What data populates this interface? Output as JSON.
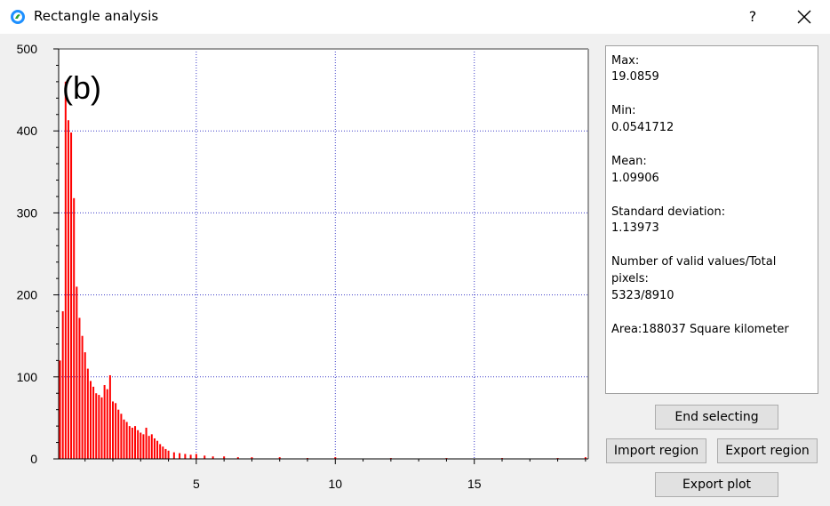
{
  "window": {
    "title": "Rectangle analysis",
    "help_label": "?",
    "accent_color": "#1e90ff"
  },
  "chart_data": {
    "type": "bar",
    "annotation": "(b)",
    "xlabel": "",
    "ylabel": "",
    "xlim": [
      0.05,
      19.1
    ],
    "ylim": [
      0,
      500
    ],
    "xticks": [
      5,
      10,
      15
    ],
    "yticks": [
      0,
      100,
      200,
      300,
      400,
      500
    ],
    "grid": true,
    "color": "#ff0000",
    "x": [
      0.1,
      0.2,
      0.3,
      0.4,
      0.5,
      0.6,
      0.7,
      0.8,
      0.9,
      1.0,
      1.1,
      1.2,
      1.3,
      1.4,
      1.5,
      1.6,
      1.7,
      1.8,
      1.9,
      2.0,
      2.1,
      2.2,
      2.3,
      2.4,
      2.5,
      2.6,
      2.7,
      2.8,
      2.9,
      3.0,
      3.1,
      3.2,
      3.3,
      3.4,
      3.5,
      3.6,
      3.7,
      3.8,
      3.9,
      4.0,
      4.2,
      4.4,
      4.6,
      4.8,
      5.0,
      5.3,
      5.6,
      6.0,
      6.5,
      7.0,
      8.0,
      9.0,
      10.0,
      12.0,
      14.0,
      16.0,
      18.0,
      19.0
    ],
    "values": [
      120,
      180,
      460,
      413,
      398,
      318,
      210,
      172,
      150,
      130,
      110,
      95,
      88,
      80,
      78,
      75,
      90,
      85,
      102,
      70,
      68,
      60,
      55,
      48,
      45,
      40,
      38,
      40,
      35,
      32,
      30,
      38,
      28,
      30,
      25,
      22,
      18,
      15,
      12,
      10,
      8,
      7,
      6,
      5,
      6,
      4,
      3,
      3,
      2,
      2,
      2,
      1,
      2,
      1,
      1,
      1,
      1,
      2
    ]
  },
  "stats": {
    "max_label": "Max:",
    "max_value": "19.0859",
    "min_label": "Min:",
    "min_value": "0.0541712",
    "mean_label": "Mean:",
    "mean_value": "1.09906",
    "std_label": "Standard deviation:",
    "std_value": "1.13973",
    "valid_label_line1": "Number of valid values/Total",
    "valid_label_line2": "pixels:",
    "valid_value": "5323/8910",
    "area_text": "Area:188037 Square kilometer"
  },
  "buttons": {
    "end_selecting": "End selecting",
    "import_region": "Import region",
    "export_region": "Export region",
    "export_plot": "Export plot"
  }
}
